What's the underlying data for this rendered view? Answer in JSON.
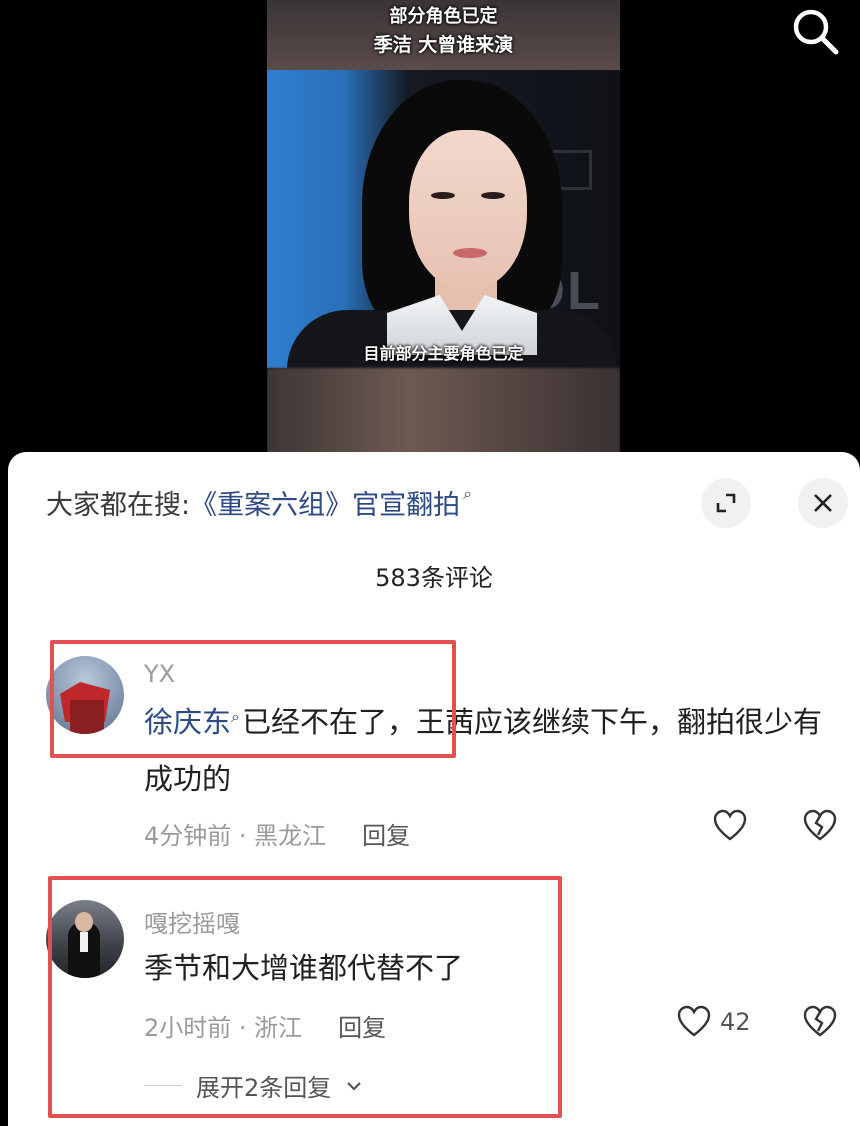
{
  "video": {
    "caption_line1": "部分角色已定",
    "caption_line2": "季洁 大曾谁来演",
    "subtitle": "目前部分主要角色已定",
    "search_icon": "search-icon"
  },
  "sheet": {
    "search_prefix": "大家都在搜:",
    "search_query": "《重案六组》官宣翻拍",
    "search_query_icon": "search-small-icon",
    "expand_icon": "expand-icon",
    "close_icon": "close-icon",
    "comment_count": "583条评论"
  },
  "comments": [
    {
      "username": "YX",
      "mention": "徐庆东",
      "text": "已经不在了，王茜应该继续下午，翻拍很少有成功的",
      "time": "4分钟前",
      "location": "黑龙江",
      "reply_label": "回复",
      "like_count": "",
      "highlighted": true
    },
    {
      "username": "嘎挖摇嘎",
      "text": "季节和大增谁都代替不了",
      "time": "2小时前",
      "location": "浙江",
      "reply_label": "回复",
      "like_count": "42",
      "expand_replies": "展开2条回复",
      "highlighted": true
    }
  ],
  "colors": {
    "link": "#2c4a86",
    "highlight": "#e0514f",
    "meta": "#9a9a9a"
  }
}
